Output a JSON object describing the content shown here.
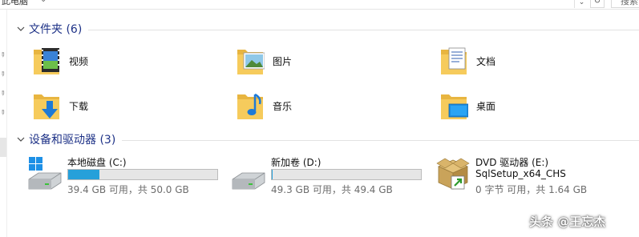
{
  "address_bar": {
    "path_text": "此电脑",
    "search_placeholder": "搜索"
  },
  "sections": {
    "folders": {
      "title": "文件夹 (6)"
    },
    "devices": {
      "title": "设备和驱动器 (3)"
    }
  },
  "folders": [
    {
      "label": "视频",
      "icon": "videos-folder-icon"
    },
    {
      "label": "图片",
      "icon": "pictures-folder-icon"
    },
    {
      "label": "文档",
      "icon": "documents-folder-icon"
    },
    {
      "label": "下载",
      "icon": "downloads-folder-icon"
    },
    {
      "label": "音乐",
      "icon": "music-folder-icon"
    },
    {
      "label": "桌面",
      "icon": "desktop-folder-icon"
    }
  ],
  "drives": [
    {
      "name": "本地磁盘 (C:)",
      "free_text": "39.4 GB 可用，共 50.0 GB",
      "used_fraction": 0.212,
      "icon": "windows-drive-icon"
    },
    {
      "name": "新加卷 (D:)",
      "free_text": "49.3 GB 可用，共 49.4 GB",
      "used_fraction": 0.002,
      "icon": "hard-drive-icon"
    },
    {
      "name": "DVD 驱动器 (E:)",
      "label2": "SqlSetup_x64_CHS",
      "free_text": "0 字节 可用，共 1.64 GB",
      "icon": "setup-package-icon"
    }
  ],
  "colors": {
    "section_title": "#1e3287",
    "bar_fill": "#26a0da",
    "bar_bg": "#e6e6e6",
    "folder_yellow": "#f6cb5c"
  },
  "watermark": "头条 @王忘杰"
}
